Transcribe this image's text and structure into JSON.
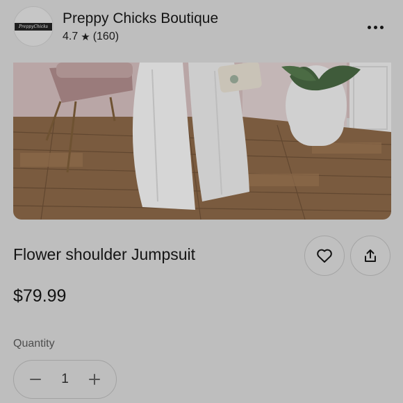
{
  "shop": {
    "name": "Preppy Chicks Boutique",
    "logo_text": "PreppyChicks",
    "rating": "4.7",
    "review_count": "(160)"
  },
  "product": {
    "title": "Flower shoulder Jumpsuit",
    "price": "$79.99",
    "image_alt": "White wide-leg jumpsuit on wood floor"
  },
  "quantity": {
    "label": "Quantity",
    "value": "1"
  },
  "icons": {
    "rating": "star-icon",
    "menu": "more-icon",
    "favorite": "heart-icon",
    "share": "share-icon",
    "decrease": "minus-icon",
    "increase": "plus-icon"
  },
  "colors": {
    "background": "#bebebe",
    "text": "#141414",
    "muted": "#4d4d4d"
  }
}
